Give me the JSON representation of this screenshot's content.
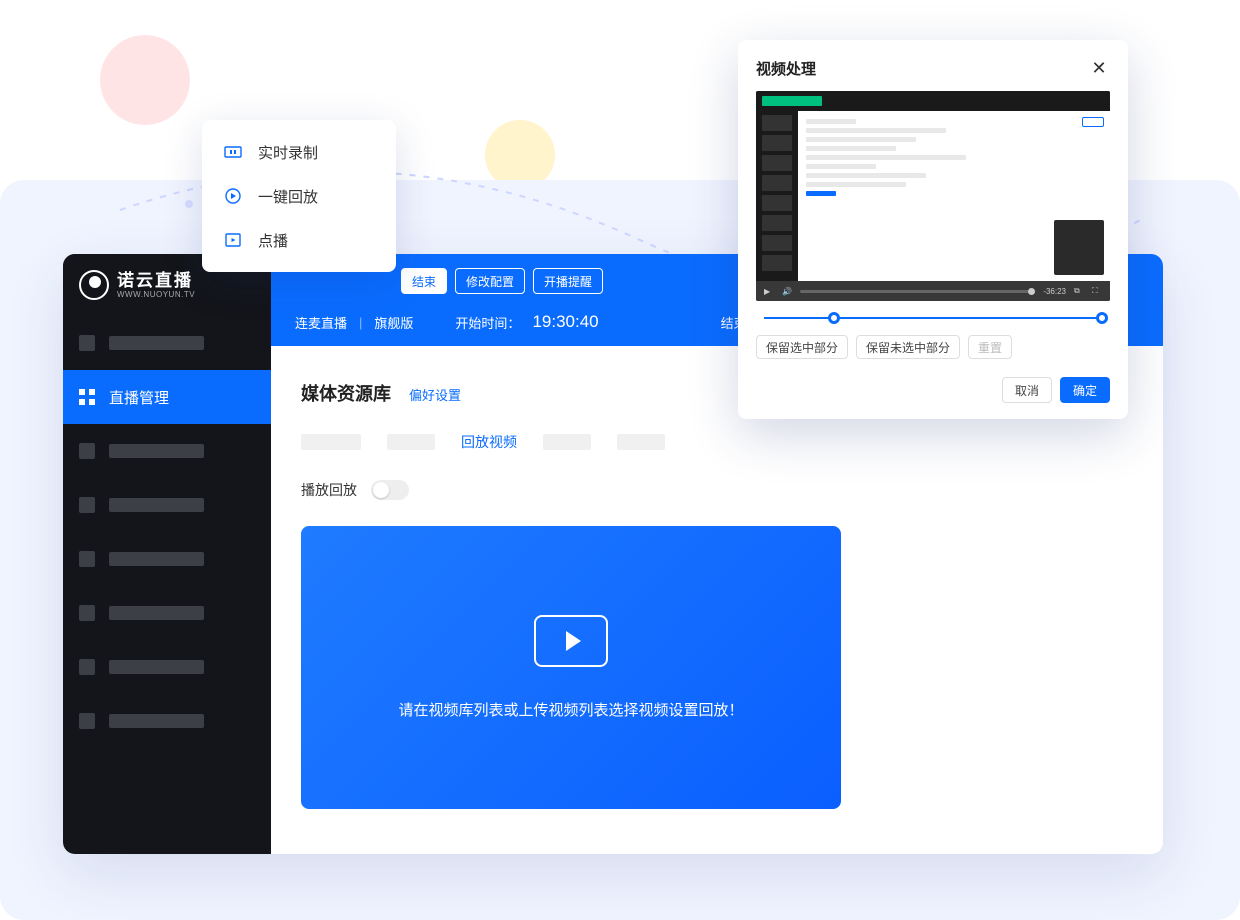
{
  "logo": {
    "cn": "诺云直播",
    "en": "WWW.NUOYUN.TV"
  },
  "sidebar": {
    "active_label": "直播管理"
  },
  "topbar": {
    "end_chip": "结束",
    "modify_chip": "修改配置",
    "remind_chip": "开播提醒",
    "line2_a": "连麦直播",
    "line2_b": "旗舰版",
    "start_label": "开始时间：",
    "start_time": "19:30:40",
    "end_label": "结束时间："
  },
  "section": {
    "title": "媒体资源库",
    "pref_link": "偏好设置",
    "active_tab": "回放视频",
    "toggle_label": "播放回放",
    "hero_text": "请在视频库列表或上传视频列表选择视频设置回放！"
  },
  "popover": {
    "item1": "实时录制",
    "item2": "一键回放",
    "item3": "点播"
  },
  "modal": {
    "title": "视频处理",
    "video_time": "-36:23",
    "chip1": "保留选中部分",
    "chip2": "保留未选中部分",
    "chip3": "重置",
    "cancel": "取消",
    "confirm": "确定"
  }
}
